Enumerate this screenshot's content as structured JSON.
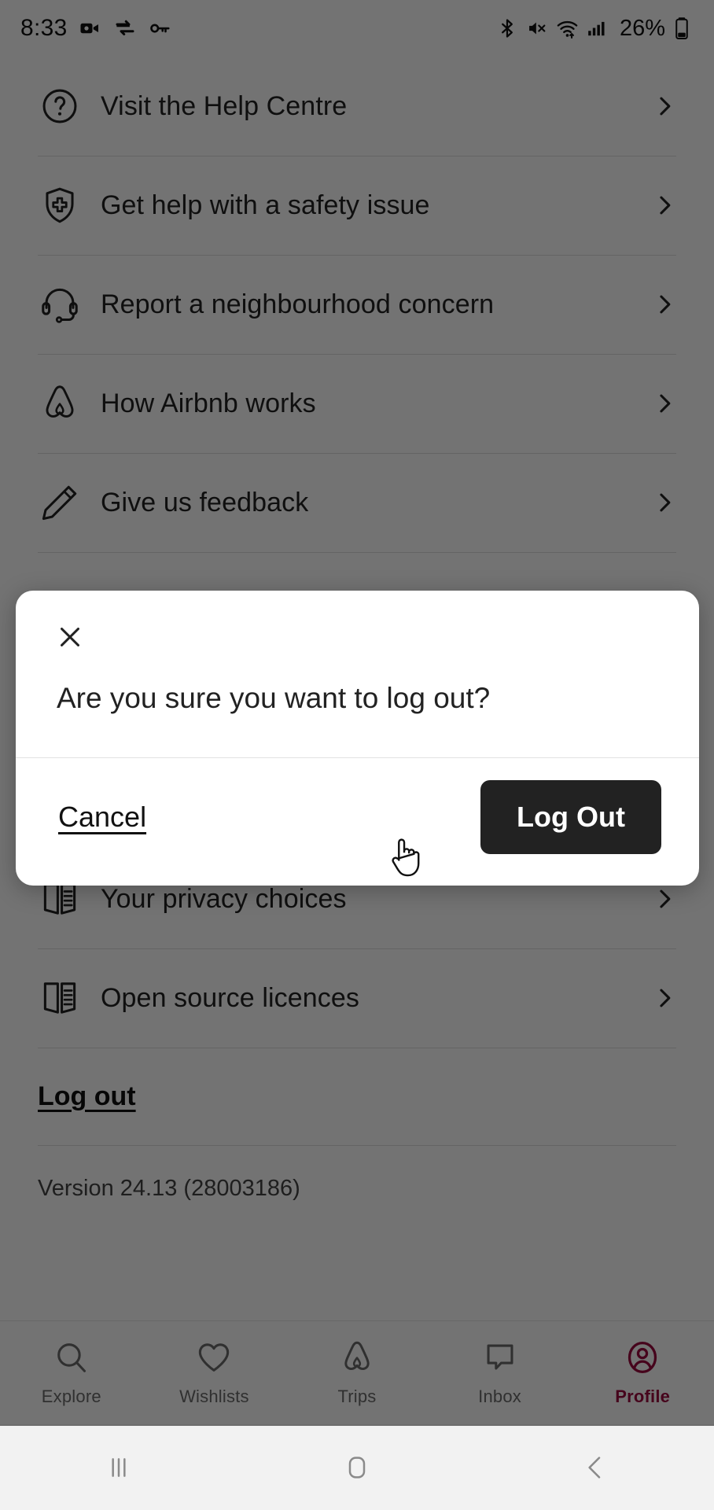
{
  "status_bar": {
    "time": "8:33",
    "battery_percent": "26%",
    "left_icons": [
      "video-camera-icon",
      "data-saver-icon",
      "vpn-key-icon"
    ],
    "right_icons": [
      "bluetooth-icon",
      "volume-muted-icon",
      "wifi-icon",
      "cellular-signal-icon",
      "battery-icon"
    ]
  },
  "settings_list": {
    "items": [
      {
        "label": "Visit the Help Centre",
        "icon": "question-circle-icon"
      },
      {
        "label": "Get help with a safety issue",
        "icon": "shield-medical-icon"
      },
      {
        "label": "Report a neighbourhood concern",
        "icon": "headset-icon"
      },
      {
        "label": "How Airbnb works",
        "icon": "airbnb-logo-icon"
      },
      {
        "label": "Give us feedback",
        "icon": "pencil-icon"
      },
      {
        "label": "Your privacy choices",
        "icon": "book-icon"
      },
      {
        "label": "Open source licences",
        "icon": "book-icon"
      }
    ],
    "log_out_link": "Log out",
    "version": "Version 24.13 (28003186)"
  },
  "modal": {
    "close_icon": "close-icon",
    "message": "Are you sure you want to log out?",
    "cancel_label": "Cancel",
    "confirm_label": "Log Out"
  },
  "tab_bar": {
    "tabs": [
      {
        "label": "Explore",
        "icon": "search-icon",
        "active": false
      },
      {
        "label": "Wishlists",
        "icon": "heart-icon",
        "active": false
      },
      {
        "label": "Trips",
        "icon": "airbnb-logo-icon",
        "active": false
      },
      {
        "label": "Inbox",
        "icon": "chat-bubble-icon",
        "active": false
      },
      {
        "label": "Profile",
        "icon": "user-circle-icon",
        "active": true
      }
    ],
    "active_color": "#9c0b3f",
    "inactive_color": "#6a6a6a"
  },
  "android_nav": {
    "recents_icon": "recents-icon",
    "home_icon": "home-icon",
    "back_icon": "back-icon"
  }
}
